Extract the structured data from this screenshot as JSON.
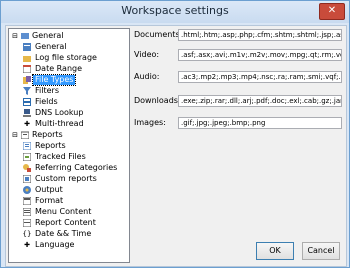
{
  "window": {
    "title": "Workspace settings"
  },
  "tree": {
    "general": {
      "label": "General",
      "children": [
        "General",
        "Log file storage",
        "Date Range",
        "File Types",
        "Filters",
        "Fields",
        "DNS Lookup",
        "Multi-thread"
      ]
    },
    "reports": {
      "label": "Reports",
      "children": [
        "Reports",
        "Tracked Files",
        "Referring Categories",
        "Custom reports",
        "Output",
        "Format",
        "Menu Content",
        "Report Content",
        "Date && Time",
        "Language"
      ]
    },
    "selected": "File Types"
  },
  "fields": {
    "documents": {
      "label": "Documents:",
      "value": ".html;.htm;.asp;.php;.cfm;.shtm;.shtml;.jsp;.aspx;.txt"
    },
    "video": {
      "label": "Video:",
      "value": ".asf;.asx;.avi;.m1v;.m2v;.mov;.mpg;.qt;.rm;.vob;.mp"
    },
    "audio": {
      "label": "Audio:",
      "value": ".ac3;.mp2;.mp3;.mp4;.nsc;.ra;.ram;.smi;.vqf;.wav;.v"
    },
    "downloads": {
      "label": "Downloads:",
      "value": ".exe;.zip;.rar;.dll;.arj;.pdf;.doc;.exl;.cab;.gz;.jar;.tar"
    },
    "images": {
      "label": "Images:",
      "value": ".gif;.jpg;.jpeg;.bmp;.png"
    }
  },
  "buttons": {
    "ok": "OK",
    "cancel": "Cancel"
  },
  "icons": {
    "close": "close-icon",
    "colors": {
      "folder": "#e6b84a",
      "doc": "#4a7fc1",
      "selected": "#3399ff",
      "close": "#c94b3b"
    }
  }
}
